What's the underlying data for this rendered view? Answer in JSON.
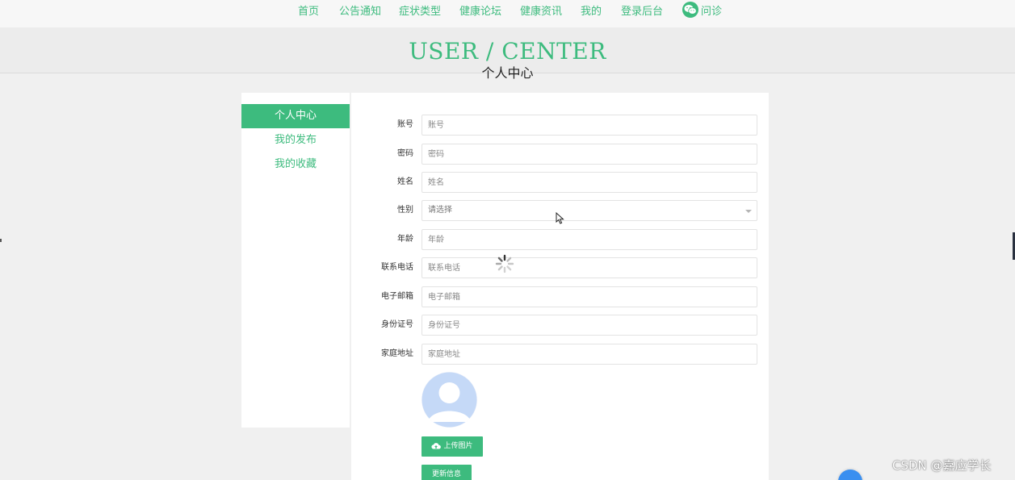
{
  "nav": {
    "items": [
      {
        "id": "home",
        "label": "首页"
      },
      {
        "id": "notice",
        "label": "公告通知"
      },
      {
        "id": "symptom",
        "label": "症状类型"
      },
      {
        "id": "forum",
        "label": "健康论坛"
      },
      {
        "id": "news",
        "label": "健康资讯"
      },
      {
        "id": "mine",
        "label": "我的"
      },
      {
        "id": "admin",
        "label": "登录后台"
      }
    ],
    "consult": {
      "label": "问诊",
      "icon": "wechat-icon"
    }
  },
  "banner": {
    "title": "USER / CENTER",
    "subtitle": "个人中心"
  },
  "sidebar": {
    "items": [
      {
        "label": "个人中心",
        "active": true
      },
      {
        "label": "我的发布",
        "active": false
      },
      {
        "label": "我的收藏",
        "active": false
      }
    ]
  },
  "form": {
    "fields": [
      {
        "label": "账号",
        "placeholder": "账号",
        "value": ""
      },
      {
        "label": "密码",
        "placeholder": "密码",
        "value": ""
      },
      {
        "label": "姓名",
        "placeholder": "姓名",
        "value": ""
      },
      {
        "label": "性别",
        "placeholder": "请选择",
        "value": "",
        "type": "select"
      },
      {
        "label": "年龄",
        "placeholder": "年龄",
        "value": ""
      },
      {
        "label": "联系电话",
        "placeholder": "联系电话",
        "value": ""
      },
      {
        "label": "电子邮箱",
        "placeholder": "电子邮箱",
        "value": ""
      },
      {
        "label": "身份证号",
        "placeholder": "身份证号",
        "value": ""
      },
      {
        "label": "家庭地址",
        "placeholder": "家庭地址",
        "value": ""
      }
    ],
    "upload_label": "上传图片",
    "update_label": "更新信息"
  },
  "watermark": "CSDN @嘉应学长",
  "colors": {
    "accent": "#3dbb7e",
    "page_bg": "#f0f0f0",
    "panel_bg": "#ffffff",
    "avatar": "#c5d9f7"
  }
}
